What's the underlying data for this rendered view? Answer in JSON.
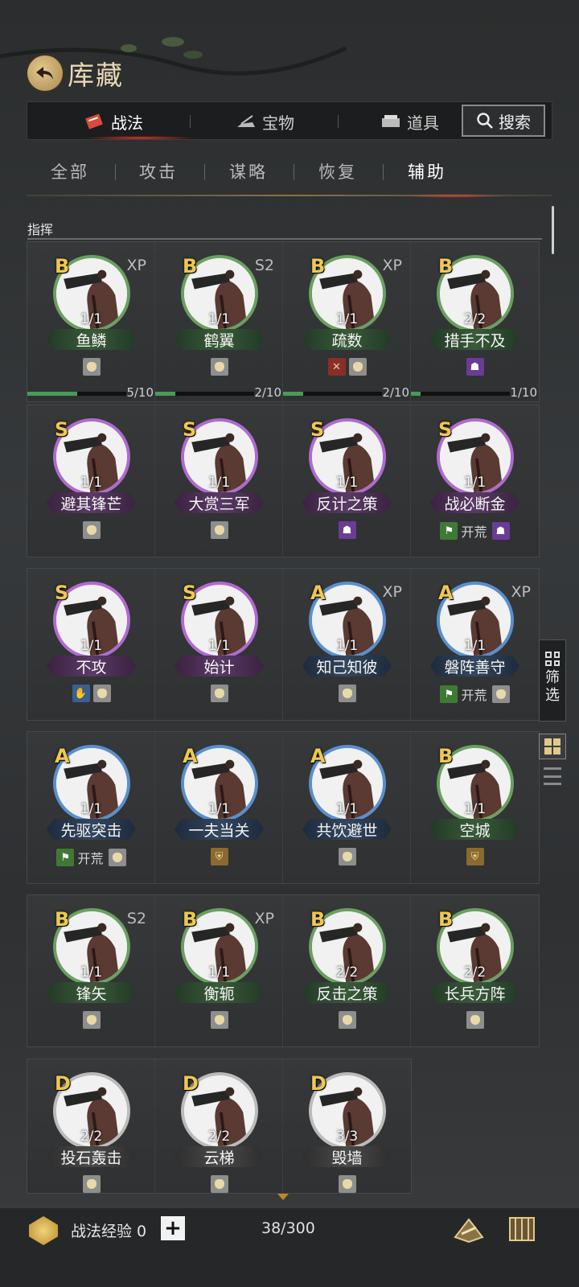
{
  "header": {
    "title": "库藏"
  },
  "top_tabs": [
    {
      "label": "战法",
      "active": true
    },
    {
      "label": "宝物",
      "active": false
    },
    {
      "label": "道具",
      "active": false
    }
  ],
  "search_label": "搜索",
  "sub_tabs": [
    {
      "label": "全部"
    },
    {
      "label": "攻击"
    },
    {
      "label": "谋略"
    },
    {
      "label": "恢复"
    },
    {
      "label": "辅助",
      "active": true
    }
  ],
  "section_title": "指挥",
  "rows": [
    {
      "cards": [
        {
          "grade": "B",
          "tag": "XP",
          "count": "1/1",
          "name": "鱼鳞",
          "icons": [
            "bag"
          ],
          "progress": "5/10",
          "progress_value": 0.5
        },
        {
          "grade": "B",
          "tag": "S2",
          "count": "1/1",
          "name": "鹤翼",
          "icons": [
            "bag"
          ],
          "progress": "2/10",
          "progress_value": 0.2
        },
        {
          "grade": "B",
          "tag": "XP",
          "count": "1/1",
          "name": "疏数",
          "icons": [
            "red",
            "bag"
          ],
          "progress": "2/10",
          "progress_value": 0.2
        },
        {
          "grade": "B",
          "tag": "",
          "count": "2/2",
          "name": "措手不及",
          "icons": [
            "purple"
          ],
          "progress": "1/10",
          "progress_value": 0.1
        }
      ]
    },
    {
      "cards": [
        {
          "grade": "S",
          "tag": "",
          "count": "1/1",
          "name": "避其锋芒",
          "icons": [
            "bag"
          ]
        },
        {
          "grade": "S",
          "tag": "",
          "count": "1/1",
          "name": "大赏三军",
          "icons": [
            "bag"
          ]
        },
        {
          "grade": "S",
          "tag": "",
          "count": "1/1",
          "name": "反计之策",
          "icons": [
            "purple"
          ]
        },
        {
          "grade": "S",
          "tag": "",
          "count": "1/1",
          "name": "战必断金",
          "icons": [
            "green",
            "kaihuang",
            "purple"
          ]
        }
      ]
    },
    {
      "cards": [
        {
          "grade": "S",
          "tag": "",
          "count": "1/1",
          "name": "不攻",
          "icons": [
            "blue",
            "bag"
          ]
        },
        {
          "grade": "S",
          "tag": "",
          "count": "1/1",
          "name": "始计",
          "icons": [
            "bag"
          ]
        },
        {
          "grade": "A",
          "tag": "XP",
          "count": "1/1",
          "name": "知己知彼",
          "icons": [
            "bag"
          ]
        },
        {
          "grade": "A",
          "tag": "XP",
          "count": "1/1",
          "name": "磐阵善守",
          "icons": [
            "green",
            "kaihuang",
            "bag"
          ]
        }
      ]
    },
    {
      "cards": [
        {
          "grade": "A",
          "tag": "",
          "count": "1/1",
          "name": "先驱突击",
          "icons": [
            "green",
            "kaihuang",
            "bag"
          ]
        },
        {
          "grade": "A",
          "tag": "",
          "count": "1/1",
          "name": "一夫当关",
          "icons": [
            "gold"
          ]
        },
        {
          "grade": "A",
          "tag": "",
          "count": "1/1",
          "name": "共饮避世",
          "icons": [
            "bag"
          ]
        },
        {
          "grade": "B",
          "tag": "",
          "count": "1/1",
          "name": "空城",
          "icons": [
            "gold"
          ]
        }
      ]
    },
    {
      "cards": [
        {
          "grade": "B",
          "tag": "S2",
          "count": "1/1",
          "name": "锋矢",
          "icons": [
            "bag"
          ]
        },
        {
          "grade": "B",
          "tag": "XP",
          "count": "1/1",
          "name": "衡轭",
          "icons": [
            "bag"
          ]
        },
        {
          "grade": "B",
          "tag": "",
          "count": "2/2",
          "name": "反击之策",
          "icons": [
            "bag"
          ]
        },
        {
          "grade": "B",
          "tag": "",
          "count": "2/2",
          "name": "长兵方阵",
          "icons": [
            "bag"
          ]
        }
      ]
    },
    {
      "cards": [
        {
          "grade": "D",
          "tag": "",
          "count": "2/2",
          "name": "投石轰击",
          "icons": [
            "bag"
          ]
        },
        {
          "grade": "D",
          "tag": "",
          "count": "2/2",
          "name": "云梯",
          "icons": [
            "bag"
          ]
        },
        {
          "grade": "D",
          "tag": "",
          "count": "3/3",
          "name": "毁墙",
          "icons": [
            "bag"
          ]
        }
      ]
    }
  ],
  "kaihuang_label": "开荒",
  "filter_label": [
    "筛",
    "选"
  ],
  "bottom": {
    "exp_label": "战法经验 0",
    "plus": "+",
    "capacity": "38/300"
  }
}
